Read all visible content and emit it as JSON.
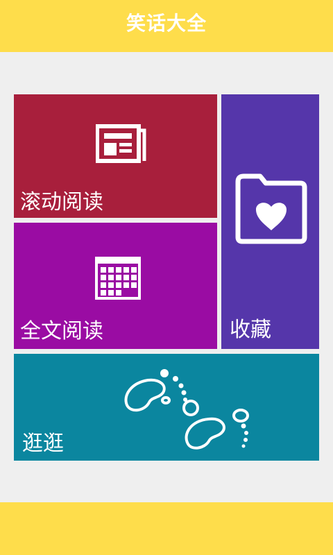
{
  "header": {
    "title": "笑话大全"
  },
  "tiles": {
    "scroll_read": {
      "label": "滚动阅读",
      "icon": "newspaper-icon"
    },
    "fulltext_read": {
      "label": "全文阅读",
      "icon": "calendar-icon"
    },
    "favorites": {
      "label": "收藏",
      "icon": "heart-folder-icon"
    },
    "browse": {
      "label": "逛逛",
      "icon": "footprints-icon"
    }
  },
  "colors": {
    "header_bg": "#fedd4b",
    "page_bg": "#efefef",
    "scroll_read_bg": "#a81f3c",
    "fulltext_read_bg": "#9a0ca3",
    "favorites_bg": "#5536aa",
    "browse_bg": "#0b869f"
  }
}
